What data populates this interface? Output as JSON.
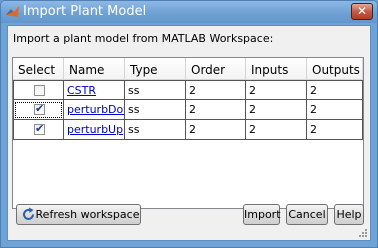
{
  "window": {
    "title": "Import Plant Model",
    "close_label": "✕"
  },
  "prompt": "Import a plant model from MATLAB Workspace:",
  "table": {
    "headers": [
      "Select",
      "Name",
      "Type",
      "Order",
      "Inputs",
      "Outputs"
    ],
    "rows": [
      {
        "selected": false,
        "name": "CSTR",
        "type": "ss",
        "order": "2",
        "inputs": "2",
        "outputs": "2"
      },
      {
        "selected": true,
        "name": "perturbDov",
        "type": "ss",
        "order": "2",
        "inputs": "2",
        "outputs": "2"
      },
      {
        "selected": true,
        "name": "perturbUp",
        "type": "ss",
        "order": "2",
        "inputs": "2",
        "outputs": "2"
      }
    ]
  },
  "buttons": {
    "refresh": "Refresh workspace",
    "import": "Import",
    "cancel": "Cancel",
    "help": "Help"
  },
  "colors": {
    "titlebar": "#6d9fd3",
    "link": "#0000cc",
    "client_bg": "#f0f0f0"
  }
}
